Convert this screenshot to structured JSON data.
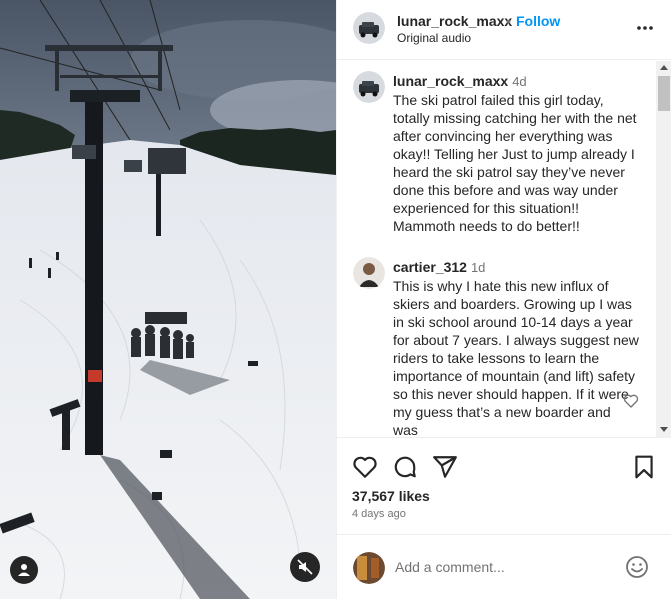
{
  "post": {
    "author": "lunar_rock_maxx",
    "separator": "•",
    "follow_label": "Follow",
    "audio": "Original audio"
  },
  "comments": [
    {
      "user": "lunar_rock_maxx",
      "time": "4d",
      "text": "The ski patrol failed this girl today, totally missing catching her with the net after convincing her everything was okay!! Telling her Just to jump already I heard the ski patrol say they’ve never done this before and was way under experienced for this situation!! Mammoth needs to do better!!"
    },
    {
      "user": "cartier_312",
      "time": "1d",
      "text": "This is why I hate this new influx of skiers and boarders. Growing up I was in ski school around 10-14 days a year for about 7 years. I always suggest new riders to take lessons to learn the importance of mountain (and lift) safety so this never should happen. If it were my guess that’s a new boarder and was"
    }
  ],
  "stats": {
    "likes": "37,567 likes",
    "posted": "4 days ago"
  },
  "add_comment": {
    "placeholder": "Add a comment..."
  },
  "icons": {
    "more": "more-options-icon",
    "like": "heart-icon",
    "comment": "comment-icon",
    "share": "share-icon",
    "save": "bookmark-icon",
    "emoji": "emoji-icon",
    "tag": "user-tag-icon",
    "mute": "muted-speaker-icon"
  }
}
